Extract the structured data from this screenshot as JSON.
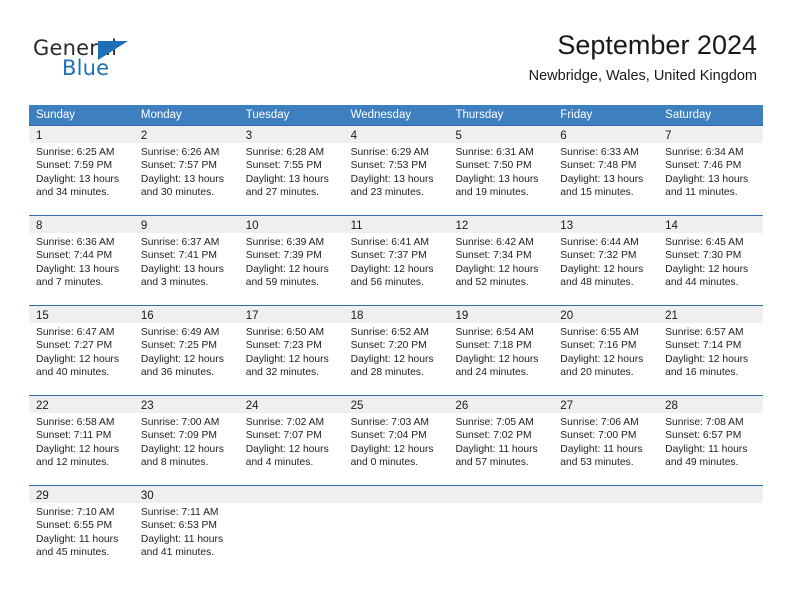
{
  "brand": {
    "name_part1": "General",
    "name_part2": "Blue",
    "accent_color": "#1d70b8"
  },
  "header": {
    "title": "September 2024",
    "subtitle": "Newbridge, Wales, United Kingdom"
  },
  "theme": {
    "header_row_color": "#3d7fbf",
    "daynum_band_color": "#efefef",
    "cell_border_color": "#2f6ca8"
  },
  "weekday_headers": [
    "Sunday",
    "Monday",
    "Tuesday",
    "Wednesday",
    "Thursday",
    "Friday",
    "Saturday"
  ],
  "weeks": [
    [
      {
        "day": "1",
        "sunrise": "Sunrise: 6:25 AM",
        "sunset": "Sunset: 7:59 PM",
        "daylight1": "Daylight: 13 hours",
        "daylight2": "and 34 minutes."
      },
      {
        "day": "2",
        "sunrise": "Sunrise: 6:26 AM",
        "sunset": "Sunset: 7:57 PM",
        "daylight1": "Daylight: 13 hours",
        "daylight2": "and 30 minutes."
      },
      {
        "day": "3",
        "sunrise": "Sunrise: 6:28 AM",
        "sunset": "Sunset: 7:55 PM",
        "daylight1": "Daylight: 13 hours",
        "daylight2": "and 27 minutes."
      },
      {
        "day": "4",
        "sunrise": "Sunrise: 6:29 AM",
        "sunset": "Sunset: 7:53 PM",
        "daylight1": "Daylight: 13 hours",
        "daylight2": "and 23 minutes."
      },
      {
        "day": "5",
        "sunrise": "Sunrise: 6:31 AM",
        "sunset": "Sunset: 7:50 PM",
        "daylight1": "Daylight: 13 hours",
        "daylight2": "and 19 minutes."
      },
      {
        "day": "6",
        "sunrise": "Sunrise: 6:33 AM",
        "sunset": "Sunset: 7:48 PM",
        "daylight1": "Daylight: 13 hours",
        "daylight2": "and 15 minutes."
      },
      {
        "day": "7",
        "sunrise": "Sunrise: 6:34 AM",
        "sunset": "Sunset: 7:46 PM",
        "daylight1": "Daylight: 13 hours",
        "daylight2": "and 11 minutes."
      }
    ],
    [
      {
        "day": "8",
        "sunrise": "Sunrise: 6:36 AM",
        "sunset": "Sunset: 7:44 PM",
        "daylight1": "Daylight: 13 hours",
        "daylight2": "and 7 minutes."
      },
      {
        "day": "9",
        "sunrise": "Sunrise: 6:37 AM",
        "sunset": "Sunset: 7:41 PM",
        "daylight1": "Daylight: 13 hours",
        "daylight2": "and 3 minutes."
      },
      {
        "day": "10",
        "sunrise": "Sunrise: 6:39 AM",
        "sunset": "Sunset: 7:39 PM",
        "daylight1": "Daylight: 12 hours",
        "daylight2": "and 59 minutes."
      },
      {
        "day": "11",
        "sunrise": "Sunrise: 6:41 AM",
        "sunset": "Sunset: 7:37 PM",
        "daylight1": "Daylight: 12 hours",
        "daylight2": "and 56 minutes."
      },
      {
        "day": "12",
        "sunrise": "Sunrise: 6:42 AM",
        "sunset": "Sunset: 7:34 PM",
        "daylight1": "Daylight: 12 hours",
        "daylight2": "and 52 minutes."
      },
      {
        "day": "13",
        "sunrise": "Sunrise: 6:44 AM",
        "sunset": "Sunset: 7:32 PM",
        "daylight1": "Daylight: 12 hours",
        "daylight2": "and 48 minutes."
      },
      {
        "day": "14",
        "sunrise": "Sunrise: 6:45 AM",
        "sunset": "Sunset: 7:30 PM",
        "daylight1": "Daylight: 12 hours",
        "daylight2": "and 44 minutes."
      }
    ],
    [
      {
        "day": "15",
        "sunrise": "Sunrise: 6:47 AM",
        "sunset": "Sunset: 7:27 PM",
        "daylight1": "Daylight: 12 hours",
        "daylight2": "and 40 minutes."
      },
      {
        "day": "16",
        "sunrise": "Sunrise: 6:49 AM",
        "sunset": "Sunset: 7:25 PM",
        "daylight1": "Daylight: 12 hours",
        "daylight2": "and 36 minutes."
      },
      {
        "day": "17",
        "sunrise": "Sunrise: 6:50 AM",
        "sunset": "Sunset: 7:23 PM",
        "daylight1": "Daylight: 12 hours",
        "daylight2": "and 32 minutes."
      },
      {
        "day": "18",
        "sunrise": "Sunrise: 6:52 AM",
        "sunset": "Sunset: 7:20 PM",
        "daylight1": "Daylight: 12 hours",
        "daylight2": "and 28 minutes."
      },
      {
        "day": "19",
        "sunrise": "Sunrise: 6:54 AM",
        "sunset": "Sunset: 7:18 PM",
        "daylight1": "Daylight: 12 hours",
        "daylight2": "and 24 minutes."
      },
      {
        "day": "20",
        "sunrise": "Sunrise: 6:55 AM",
        "sunset": "Sunset: 7:16 PM",
        "daylight1": "Daylight: 12 hours",
        "daylight2": "and 20 minutes."
      },
      {
        "day": "21",
        "sunrise": "Sunrise: 6:57 AM",
        "sunset": "Sunset: 7:14 PM",
        "daylight1": "Daylight: 12 hours",
        "daylight2": "and 16 minutes."
      }
    ],
    [
      {
        "day": "22",
        "sunrise": "Sunrise: 6:58 AM",
        "sunset": "Sunset: 7:11 PM",
        "daylight1": "Daylight: 12 hours",
        "daylight2": "and 12 minutes."
      },
      {
        "day": "23",
        "sunrise": "Sunrise: 7:00 AM",
        "sunset": "Sunset: 7:09 PM",
        "daylight1": "Daylight: 12 hours",
        "daylight2": "and 8 minutes."
      },
      {
        "day": "24",
        "sunrise": "Sunrise: 7:02 AM",
        "sunset": "Sunset: 7:07 PM",
        "daylight1": "Daylight: 12 hours",
        "daylight2": "and 4 minutes."
      },
      {
        "day": "25",
        "sunrise": "Sunrise: 7:03 AM",
        "sunset": "Sunset: 7:04 PM",
        "daylight1": "Daylight: 12 hours",
        "daylight2": "and 0 minutes."
      },
      {
        "day": "26",
        "sunrise": "Sunrise: 7:05 AM",
        "sunset": "Sunset: 7:02 PM",
        "daylight1": "Daylight: 11 hours",
        "daylight2": "and 57 minutes."
      },
      {
        "day": "27",
        "sunrise": "Sunrise: 7:06 AM",
        "sunset": "Sunset: 7:00 PM",
        "daylight1": "Daylight: 11 hours",
        "daylight2": "and 53 minutes."
      },
      {
        "day": "28",
        "sunrise": "Sunrise: 7:08 AM",
        "sunset": "Sunset: 6:57 PM",
        "daylight1": "Daylight: 11 hours",
        "daylight2": "and 49 minutes."
      }
    ],
    [
      {
        "day": "29",
        "sunrise": "Sunrise: 7:10 AM",
        "sunset": "Sunset: 6:55 PM",
        "daylight1": "Daylight: 11 hours",
        "daylight2": "and 45 minutes."
      },
      {
        "day": "30",
        "sunrise": "Sunrise: 7:11 AM",
        "sunset": "Sunset: 6:53 PM",
        "daylight1": "Daylight: 11 hours",
        "daylight2": "and 41 minutes."
      },
      {
        "day": "",
        "sunrise": "",
        "sunset": "",
        "daylight1": "",
        "daylight2": ""
      },
      {
        "day": "",
        "sunrise": "",
        "sunset": "",
        "daylight1": "",
        "daylight2": ""
      },
      {
        "day": "",
        "sunrise": "",
        "sunset": "",
        "daylight1": "",
        "daylight2": ""
      },
      {
        "day": "",
        "sunrise": "",
        "sunset": "",
        "daylight1": "",
        "daylight2": ""
      },
      {
        "day": "",
        "sunrise": "",
        "sunset": "",
        "daylight1": "",
        "daylight2": ""
      }
    ]
  ]
}
